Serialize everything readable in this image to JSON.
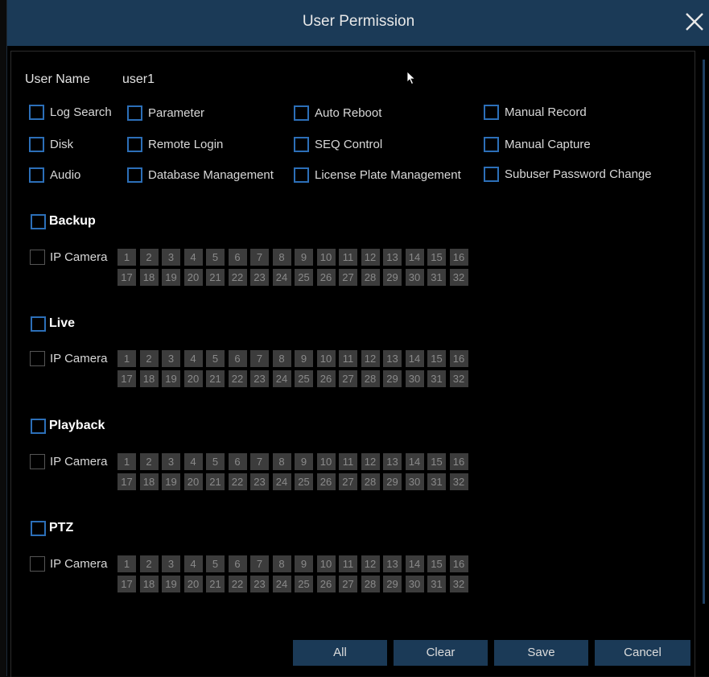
{
  "dialog": {
    "title": "User Permission",
    "close_icon": "close-icon"
  },
  "user": {
    "label": "User Name",
    "value": "user1"
  },
  "permissions": [
    {
      "id": "log-search",
      "label": "Log Search",
      "checked": false
    },
    {
      "id": "parameter",
      "label": "Parameter",
      "checked": false
    },
    {
      "id": "auto-reboot",
      "label": "Auto Reboot",
      "checked": false
    },
    {
      "id": "manual-record",
      "label": "Manual Record",
      "checked": false
    },
    {
      "id": "disk",
      "label": "Disk",
      "checked": false
    },
    {
      "id": "remote-login",
      "label": "Remote Login",
      "checked": false
    },
    {
      "id": "seq-control",
      "label": "SEQ Control",
      "checked": false
    },
    {
      "id": "manual-capture",
      "label": "Manual Capture",
      "checked": false
    },
    {
      "id": "audio",
      "label": "Audio",
      "checked": false
    },
    {
      "id": "database-management",
      "label": "Database Management",
      "checked": false
    },
    {
      "id": "license-plate-management",
      "label": "License Plate Management",
      "checked": false
    },
    {
      "id": "subuser-password-change",
      "label": "Subuser Password Change",
      "checked": false
    }
  ],
  "sections": [
    {
      "id": "backup",
      "title": "Backup",
      "ip_camera_label": "IP Camera"
    },
    {
      "id": "live",
      "title": "Live",
      "ip_camera_label": "IP Camera"
    },
    {
      "id": "playback",
      "title": "Playback",
      "ip_camera_label": "IP Camera"
    },
    {
      "id": "ptz",
      "title": "PTZ",
      "ip_camera_label": "IP Camera"
    }
  ],
  "channels": [
    "1",
    "2",
    "3",
    "4",
    "5",
    "6",
    "7",
    "8",
    "9",
    "10",
    "11",
    "12",
    "13",
    "14",
    "15",
    "16",
    "17",
    "18",
    "19",
    "20",
    "21",
    "22",
    "23",
    "24",
    "25",
    "26",
    "27",
    "28",
    "29",
    "30",
    "31",
    "32"
  ],
  "footer": {
    "all_label": "All",
    "clear_label": "Clear",
    "save_label": "Save",
    "cancel_label": "Cancel"
  },
  "colors": {
    "titlebar": "#1b3a57",
    "checkbox_border": "#2c6fb8",
    "channel_bg": "#3c3c3c",
    "channel_text": "#8a8a8a"
  }
}
